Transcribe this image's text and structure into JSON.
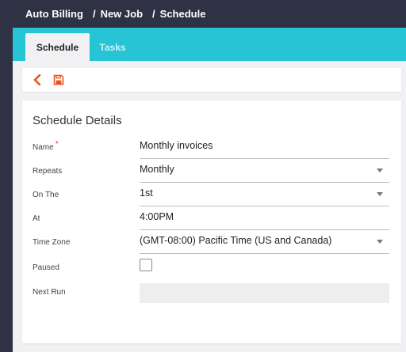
{
  "breadcrumb": {
    "items": [
      "Auto Billing",
      "New Job",
      "Schedule"
    ],
    "separator": "/"
  },
  "tabs": [
    {
      "label": "Schedule",
      "active": true
    },
    {
      "label": "Tasks",
      "active": false
    }
  ],
  "toolbar": {
    "back_icon": "chevron-left-icon",
    "save_icon": "save-icon",
    "accent_color": "#e8541a"
  },
  "panel": {
    "title": "Schedule Details",
    "fields": {
      "name": {
        "label": "Name",
        "value": "Monthly invoices",
        "required": true
      },
      "repeats": {
        "label": "Repeats",
        "value": "Monthly"
      },
      "on_the": {
        "label": "On The",
        "value": "1st"
      },
      "at": {
        "label": "At",
        "value": "4:00PM"
      },
      "time_zone": {
        "label": "Time Zone",
        "value": "(GMT-08:00) Pacific Time (US and Canada)"
      },
      "paused": {
        "label": "Paused",
        "checked": false
      },
      "next_run": {
        "label": "Next Run",
        "value": ""
      }
    }
  },
  "colors": {
    "topbar": "#2f3145",
    "tabbar": "#27c4d6",
    "required_marker": "#e53935"
  }
}
